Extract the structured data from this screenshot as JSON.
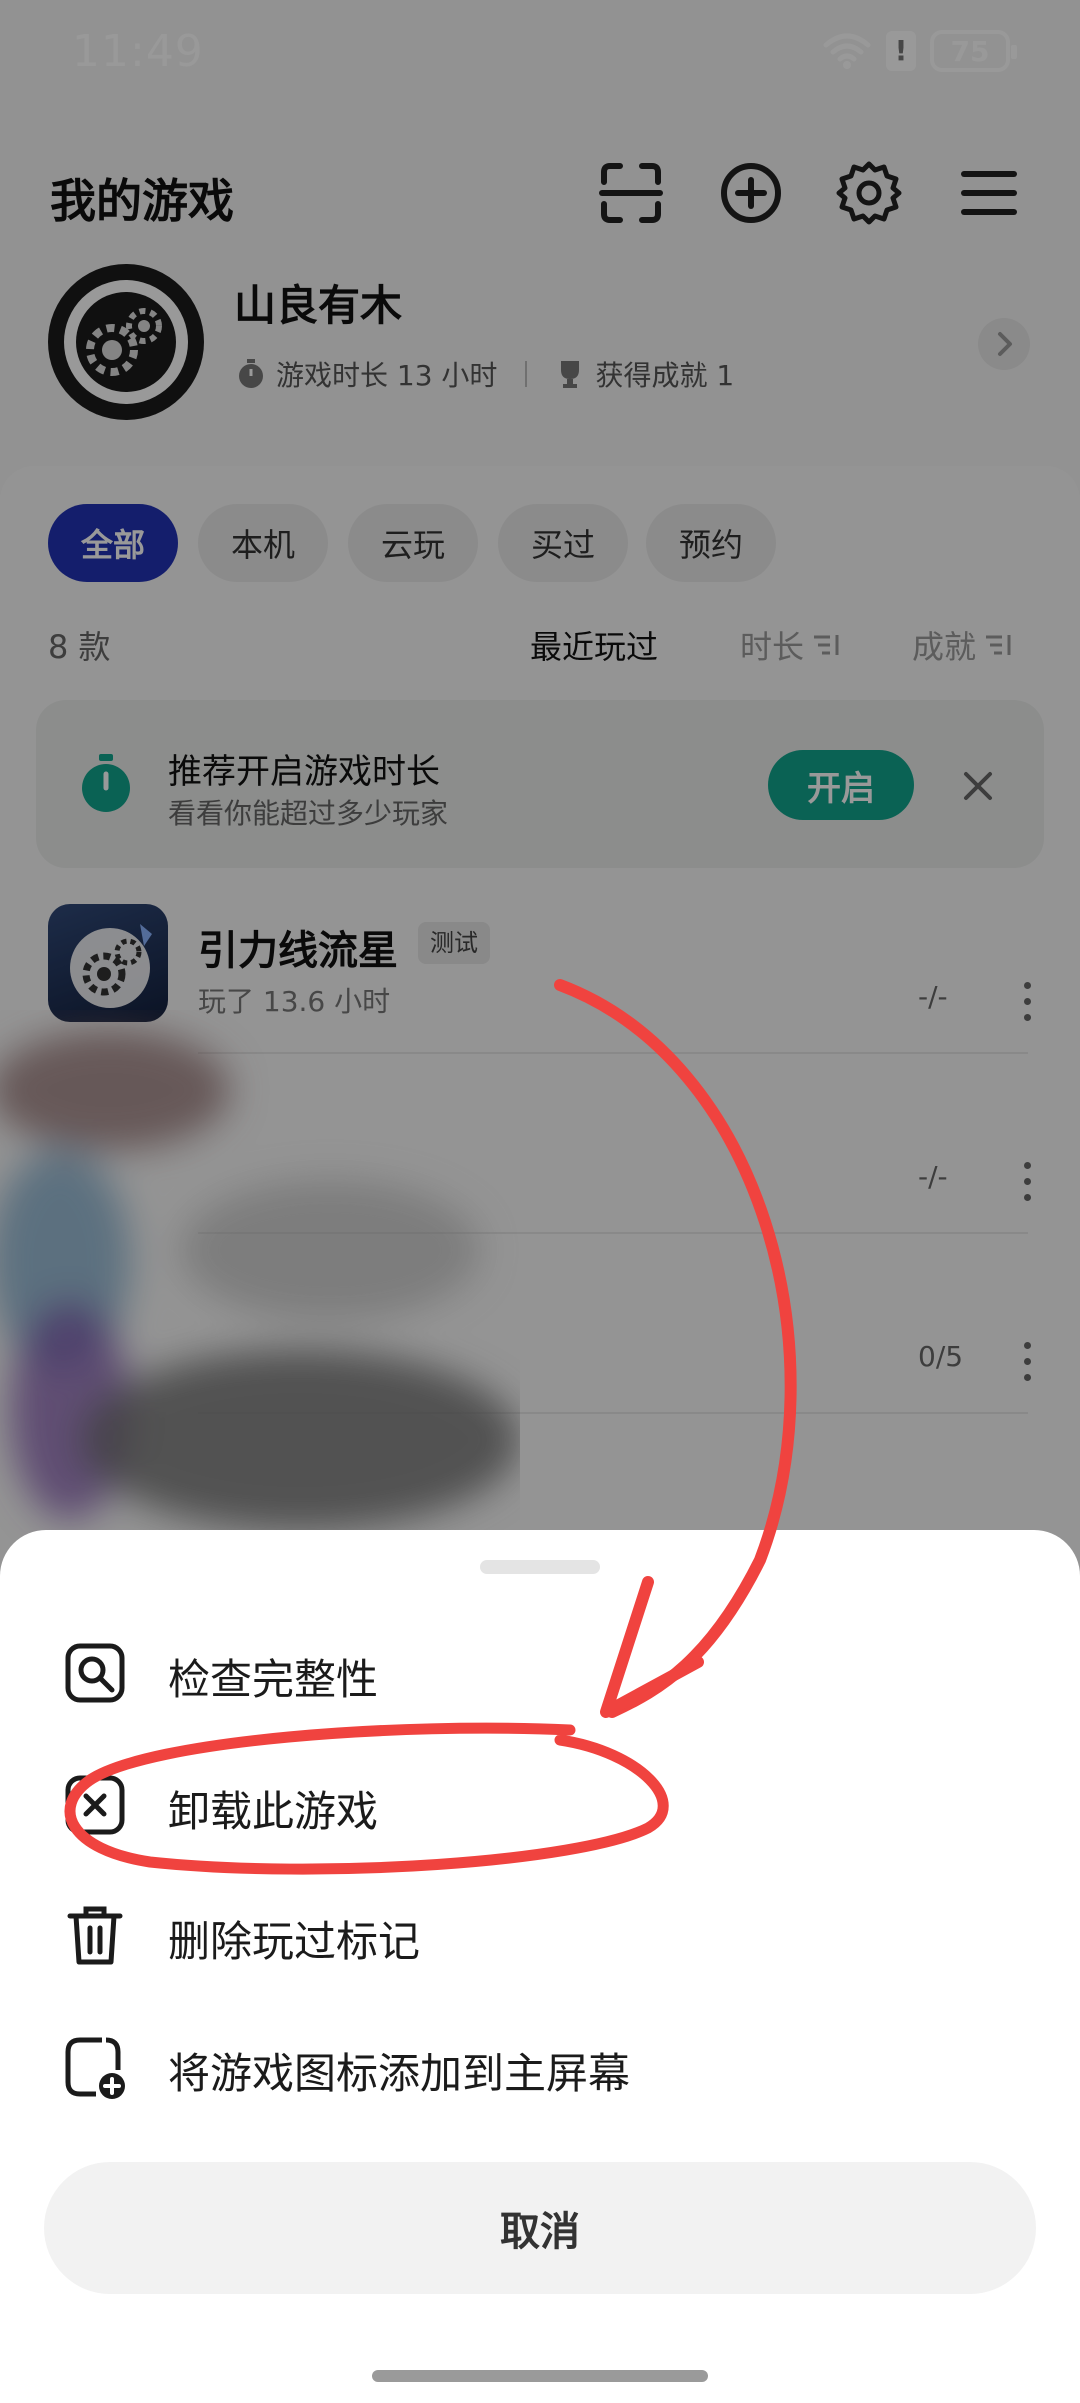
{
  "status_bar": {
    "time": "11:49",
    "battery": "75",
    "alert": "!"
  },
  "header": {
    "title": "我的游戏",
    "icons": [
      "scan-icon",
      "add-circle-icon",
      "settings-gear-icon",
      "menu-icon"
    ]
  },
  "profile": {
    "name": "山良有木",
    "playtime": "游戏时长 13 小时",
    "achievements": "获得成就 1"
  },
  "filters": {
    "chips": [
      "全部",
      "本机",
      "云玩",
      "买过",
      "预约"
    ],
    "active": "全部"
  },
  "list_info": {
    "count": "8 款",
    "sort_options": [
      "最近玩过",
      "时长",
      "成就"
    ],
    "active_sort": "最近玩过"
  },
  "recommend": {
    "title": "推荐开启游戏时长",
    "subtitle": "看看你能超过多少玩家",
    "button": "开启"
  },
  "games": [
    {
      "name": "引力线流星",
      "tag": "测试",
      "playtime": "玩了 13.6 小时",
      "progress": "-/-"
    },
    {
      "progress": "-/-"
    },
    {
      "progress": "0/5"
    }
  ],
  "sheet": {
    "menu": [
      {
        "label": "检查完整性",
        "icon": "search-document-icon"
      },
      {
        "label": "卸载此游戏",
        "icon": "uninstall-x-icon"
      },
      {
        "label": "删除玩过标记",
        "icon": "trash-icon"
      },
      {
        "label": "将游戏图标添加到主屏幕",
        "icon": "add-to-homescreen-icon"
      }
    ],
    "cancel": "取消"
  },
  "colors": {
    "accent": "#2233b5",
    "teal": "#12a38c",
    "annotation": "#f0433f"
  }
}
